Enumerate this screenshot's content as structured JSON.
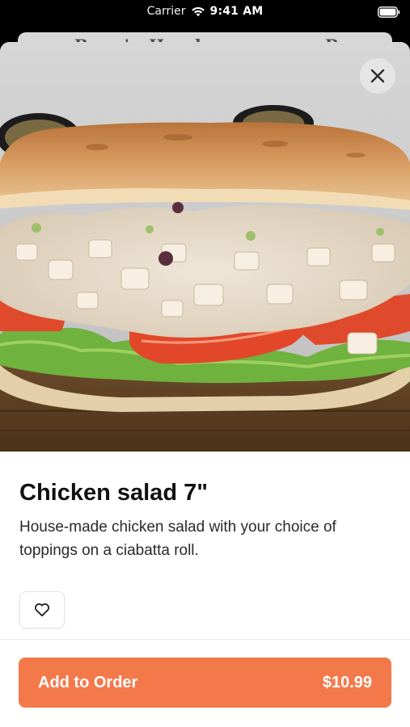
{
  "status_bar": {
    "carrier": "Carrier",
    "time": "9:41 AM",
    "icons": [
      "wifi-icon",
      "battery-icon"
    ]
  },
  "background_sheet": {
    "partial_text_left": "Boar's Head",
    "partial_text_right": "Bo"
  },
  "product": {
    "image_subject": "Chicken salad sandwich on ciabatta with lettuce and tomato",
    "title": "Chicken salad 7\"",
    "description": "House-made chicken salad with your choice of toppings on a ciabatta roll.",
    "favorite_icon": "heart-outline-icon"
  },
  "actions": {
    "close_icon": "close-icon",
    "add_to_order_label": "Add to Order",
    "price": "$10.99"
  },
  "colors": {
    "accent": "#f4794a",
    "text_primary": "#111111",
    "text_secondary": "#2a2a2a",
    "status_bar_bg": "#000000"
  }
}
